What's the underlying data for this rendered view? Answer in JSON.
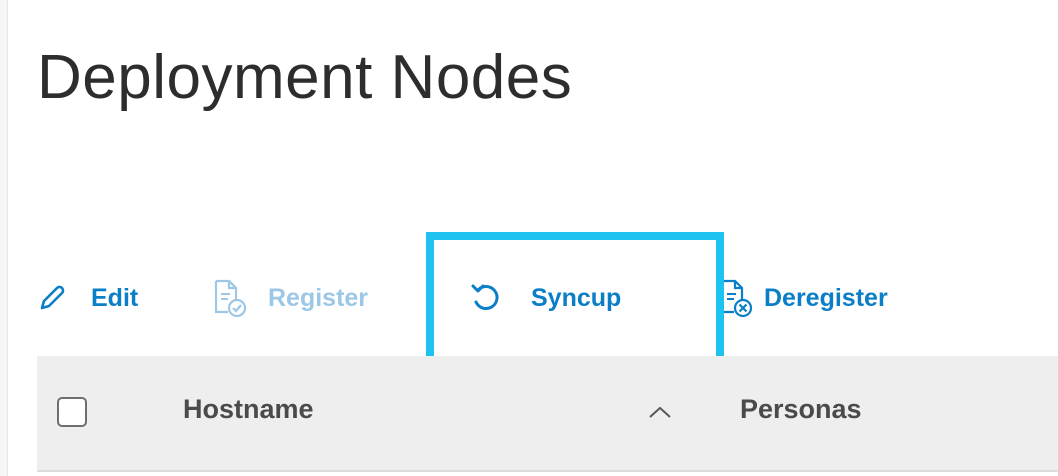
{
  "page": {
    "title": "Deployment Nodes"
  },
  "toolbar": {
    "edit_label": "Edit",
    "register_label": "Register",
    "syncup_label": "Syncup",
    "deregister_label": "Deregister"
  },
  "table": {
    "columns": [
      "Hostname",
      "Personas"
    ],
    "sort": {
      "column": "Hostname",
      "direction": "ascending"
    },
    "select_all_checked": false
  },
  "colors": {
    "accent": "#0b7ec8",
    "disabled": "#9cc7e6",
    "highlight": "#1ec2ef",
    "header_bg": "#eeeeee"
  },
  "icons": {
    "edit": "pencil-icon",
    "register": "register-document-icon",
    "syncup": "sync-icon",
    "deregister": "deregister-document-icon",
    "sort": "chevron-up-icon"
  }
}
